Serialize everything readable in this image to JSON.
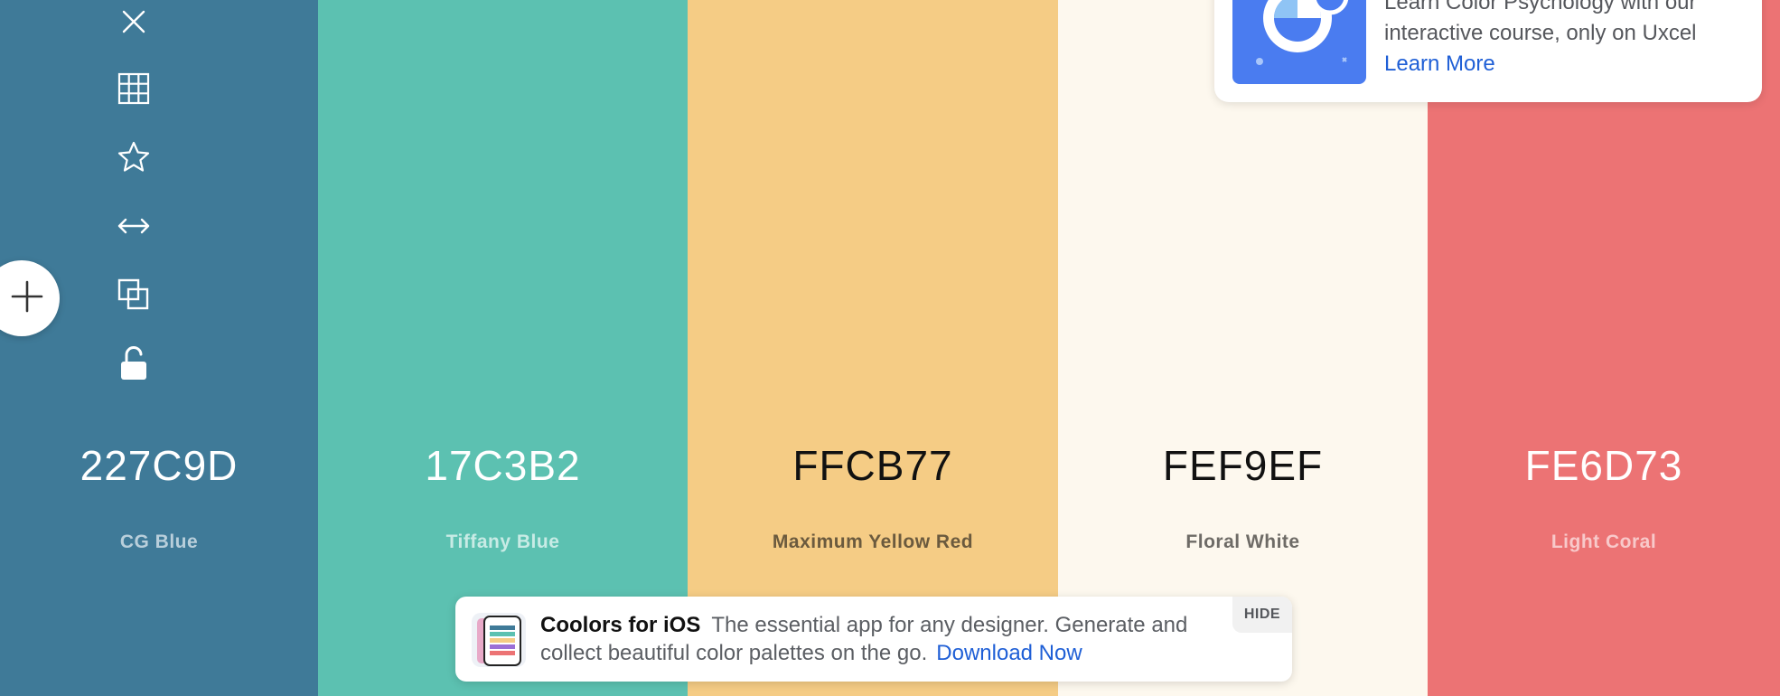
{
  "toolbar": {
    "icons": [
      "close-icon",
      "grid-icon",
      "star-icon",
      "arrows-horizontal-icon",
      "copy-icon",
      "unlock-icon"
    ],
    "add_icon": "plus-icon"
  },
  "swatches": [
    {
      "hex": "227C9D",
      "name": "CG Blue",
      "color": "#3f7a98",
      "text_color": "#ffffff",
      "name_color": "#b9cfdb"
    },
    {
      "hex": "17C3B2",
      "name": "Tiffany Blue",
      "color": "#5cc1b1",
      "text_color": "#ffffff",
      "name_color": "#c8ebe5"
    },
    {
      "hex": "FFCB77",
      "name": "Maximum Yellow Red",
      "color": "#f5cc85",
      "text_color": "#111111",
      "name_color": "#6b5a3e"
    },
    {
      "hex": "FEF9EF",
      "name": "Floral White",
      "color": "#fdf8ee",
      "text_color": "#111111",
      "name_color": "#6e6b66"
    },
    {
      "hex": "FE6D73",
      "name": "Light Coral",
      "color": "#ec7374",
      "text_color": "#ffffff",
      "name_color": "#f8c9ca"
    }
  ],
  "promo": {
    "line1": "Learn Color Psychology with our",
    "line2": "interactive course, only on Uxcel",
    "link": "Learn More",
    "thumb_color": "#4a7cf0"
  },
  "ios_banner": {
    "title": "Coolors for iOS",
    "text": "The essential app for any designer. Generate and collect beautiful color palettes on the go.",
    "link": "Download Now",
    "hide_label": "HIDE"
  },
  "colors": {
    "link": "#1f5fd6"
  }
}
